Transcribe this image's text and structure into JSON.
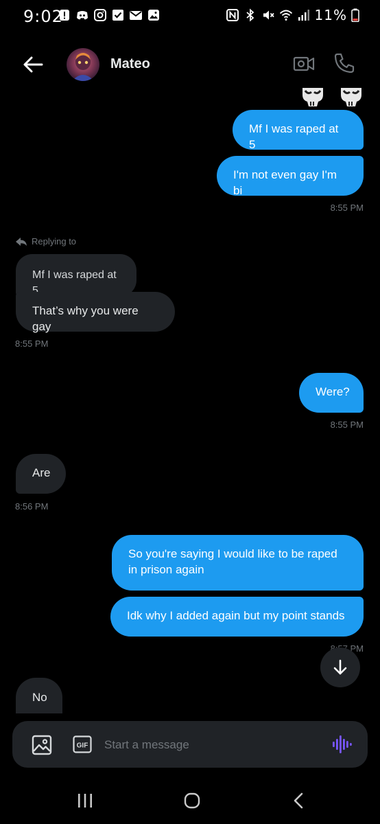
{
  "status_bar": {
    "time": "9:02",
    "battery": "11%",
    "icons": [
      "alert-icon",
      "discord-icon",
      "instagram-icon",
      "check-icon",
      "mail-icon",
      "gallery-icon",
      "nfc-icon",
      "bluetooth-icon",
      "mute-icon",
      "wifi-icon",
      "signal-icon",
      "battery-icon"
    ]
  },
  "header": {
    "contact_name": "Mateo",
    "icons": [
      "back-arrow-icon",
      "avatar",
      "video-call-icon",
      "phone-icon"
    ]
  },
  "messages": [
    {
      "direction": "out",
      "text": "Mf I was raped at 5"
    },
    {
      "direction": "out",
      "text": "I'm not even gay I'm bi",
      "time": "8:55 PM"
    },
    {
      "direction": "in",
      "reply_label": "Replying to",
      "quoted": "Mf I was raped at 5",
      "text": "That’s why you were gay",
      "time": "8:55 PM"
    },
    {
      "direction": "out",
      "text": "Were?",
      "time": "8:55 PM"
    },
    {
      "direction": "in",
      "text": "Are",
      "time": "8:56 PM"
    },
    {
      "direction": "out",
      "text": "So you're saying I would like to be raped in prison again"
    },
    {
      "direction": "out",
      "text": "Idk why I added again but my point stands",
      "time": "8:57 PM"
    },
    {
      "direction": "in",
      "text": "No"
    }
  ],
  "composer": {
    "placeholder": "Start a message",
    "gif_label": "GIF"
  },
  "colors": {
    "background": "#000000",
    "outgoing_bubble": "#1d9bf0",
    "incoming_bubble": "#202327",
    "muted_text": "#71767b",
    "voice_accent": "#7856ff"
  }
}
